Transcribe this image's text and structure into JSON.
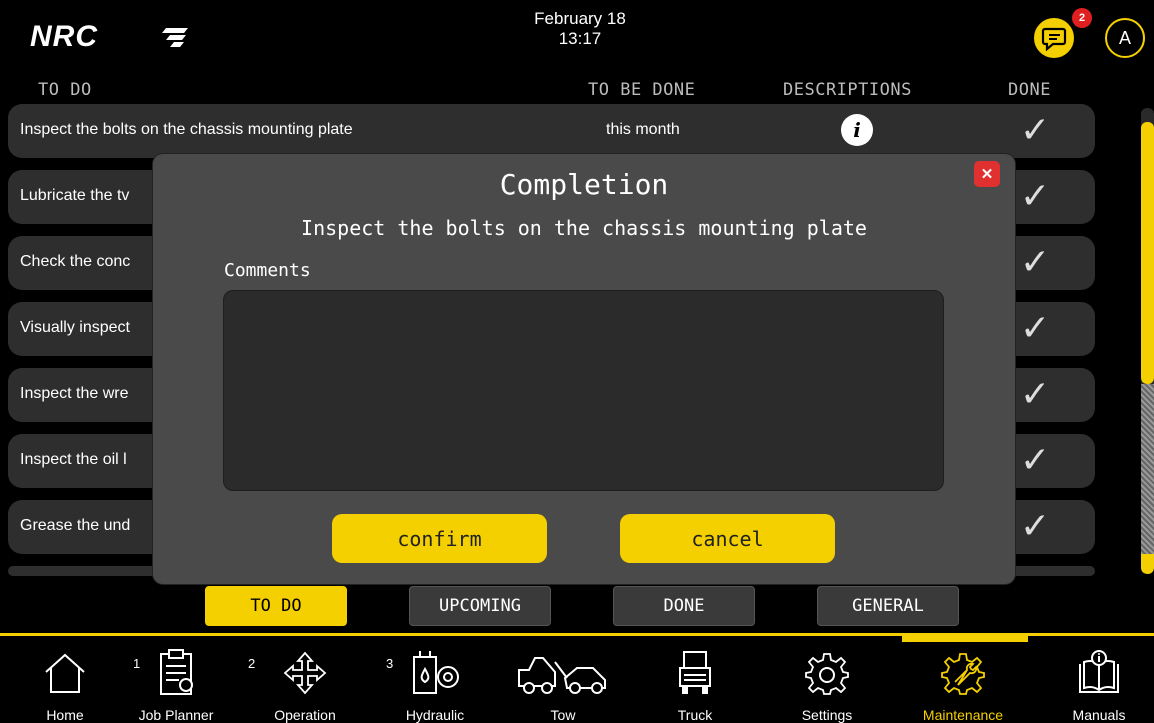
{
  "header": {
    "logo": "NRC",
    "date": "February 18",
    "time": "13:17",
    "notification_count": "2",
    "avatar_initial": "A"
  },
  "columns": {
    "todo": "TO DO",
    "to_be_done": "TO BE DONE",
    "descriptions": "DESCRIPTIONS",
    "done": "DONE"
  },
  "rows": [
    {
      "task": "Inspect the bolts on the chassis mounting plate",
      "when": "this month"
    },
    {
      "task": "Lubricate the tv",
      "when": ""
    },
    {
      "task": "Check the conc",
      "when": ""
    },
    {
      "task": "Visually inspect",
      "when": ""
    },
    {
      "task": "Inspect the wre",
      "when": ""
    },
    {
      "task": "Inspect the oil l",
      "when": ""
    },
    {
      "task": "Grease the und",
      "when": ""
    }
  ],
  "icons": {
    "info": "i",
    "check": "✓",
    "close": "✕"
  },
  "tabs": [
    {
      "label": "TO DO",
      "active": true
    },
    {
      "label": "UPCOMING",
      "active": false
    },
    {
      "label": "DONE",
      "active": false
    },
    {
      "label": "GENERAL",
      "active": false
    }
  ],
  "nav": [
    {
      "label": "Home",
      "number": "",
      "icon": "home-icon"
    },
    {
      "label": "Job Planner",
      "number": "1",
      "icon": "clipboard-icon"
    },
    {
      "label": "Operation",
      "number": "2",
      "icon": "move-arrows-icon"
    },
    {
      "label": "Hydraulic",
      "number": "3",
      "icon": "hydraulic-icon"
    },
    {
      "label": "Tow",
      "number": "",
      "icon": "tow-truck-icon"
    },
    {
      "label": "Truck",
      "number": "",
      "icon": "truck-icon"
    },
    {
      "label": "Settings",
      "number": "",
      "icon": "gear-icon"
    },
    {
      "label": "Maintenance",
      "number": "",
      "icon": "maintenance-gear-icon",
      "active": true
    },
    {
      "label": "Manuals",
      "number": "",
      "icon": "manual-book-icon"
    }
  ],
  "modal": {
    "title": "Completion",
    "subtitle": "Inspect the bolts on the chassis mounting plate",
    "comments_label": "Comments",
    "comments_value": "",
    "confirm_label": "confirm",
    "cancel_label": "cancel"
  },
  "colors": {
    "accent": "#f5d000",
    "row_bg": "#2e2e2e",
    "modal_bg": "#4a4a4a",
    "close_red": "#e03030"
  }
}
